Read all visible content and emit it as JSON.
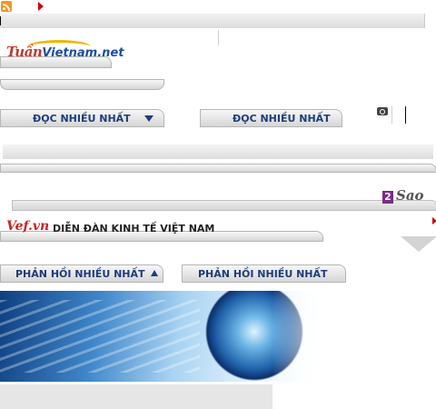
{
  "header": {
    "rss_icon": "rss-icon",
    "arrow_icon": "arrow-right-icon"
  },
  "logos": {
    "tuanvietnam": {
      "part1": "Tuần",
      "part2": "Vietnam.net"
    },
    "vef": {
      "mark": "Vef.vn",
      "subtitle": "DIỄN ĐÀN KINH TẾ VIỆT NAM"
    },
    "sao": {
      "digit": "2",
      "word": "Sao"
    }
  },
  "tabs": {
    "most_read_1": "ĐỌC NHIỀU NHẤT",
    "most_read_2": "ĐỌC NHIỀU NHẤT",
    "most_feedback_1": "PHẢN HỒI NHIỀU NHẤT",
    "most_feedback_2": "PHẢN HỒI NHIỀU NHẤT"
  },
  "icons": {
    "camera": "camera-icon",
    "dropdown": "triangle-down-icon",
    "sort_up": "triangle-up-icon"
  },
  "colors": {
    "tab_text": "#1d3d7a",
    "accent_red": "#cc0000",
    "rss": "#f7931e"
  }
}
